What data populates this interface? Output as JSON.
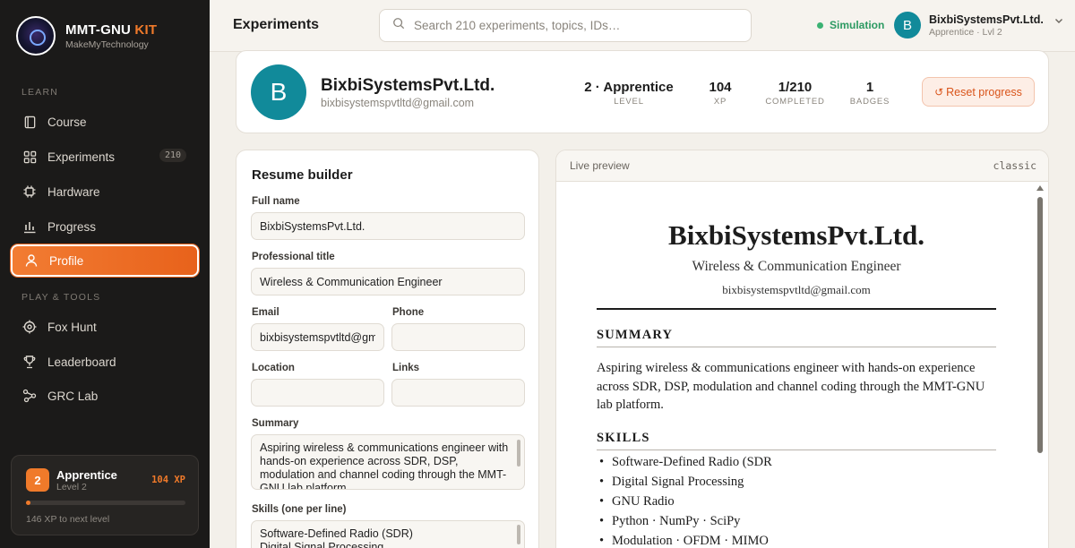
{
  "brand": {
    "title_main": "MMT-GNU ",
    "title_accent": "KIT",
    "subtitle": "MakeMyTechnology"
  },
  "sidebar": {
    "learn_label": "LEARN",
    "tools_label": "PLAY & TOOLS",
    "items": [
      {
        "label": "Course",
        "icon": "book-icon"
      },
      {
        "label": "Experiments",
        "icon": "grid-icon",
        "badge": "210"
      },
      {
        "label": "Hardware",
        "icon": "chip-icon"
      },
      {
        "label": "Progress",
        "icon": "bar-chart-icon"
      },
      {
        "label": "Profile",
        "icon": "user-icon",
        "active": true
      },
      {
        "label": "Fox Hunt",
        "icon": "target-icon"
      },
      {
        "label": "Leaderboard",
        "icon": "trophy-icon"
      },
      {
        "label": "GRC Lab",
        "icon": "graph-icon"
      }
    ],
    "level_card": {
      "level": "2",
      "title": "Apprentice",
      "sub": "Level 2",
      "xp": "104 XP",
      "progress": 0.03,
      "next": "146 XP to next level"
    }
  },
  "topbar": {
    "title": "Experiments",
    "search_placeholder": "Search 210 experiments, topics, IDs…",
    "mode": "Simulation",
    "user": {
      "initial": "B",
      "name": "BixbiSystemsPvt.Ltd.",
      "sub": "Apprentice · Lvl 2"
    }
  },
  "profile": {
    "initial": "B",
    "name": "BixbiSystemsPvt.Ltd.",
    "email": "bixbisystemspvtltd@gmail.com",
    "stats": [
      {
        "value": "2 · Apprentice",
        "label": "LEVEL"
      },
      {
        "value": "104",
        "label": "XP"
      },
      {
        "value": "1/210",
        "label": "COMPLETED"
      },
      {
        "value": "1",
        "label": "BADGES"
      }
    ],
    "reset_label": "Reset progress"
  },
  "builder": {
    "title": "Resume builder",
    "full_name_label": "Full name",
    "full_name": "BixbiSystemsPvt.Ltd.",
    "prof_title_label": "Professional title",
    "prof_title": "Wireless & Communication Engineer",
    "email_label": "Email",
    "email": "bixbisystemspvtltd@gmail.com",
    "phone_label": "Phone",
    "phone": "",
    "location_label": "Location",
    "location": "",
    "links_label": "Links",
    "links": "",
    "summary_label": "Summary",
    "summary": "Aspiring wireless & communications engineer with hands-on experience across SDR, DSP, modulation and channel coding through the MMT-GNU lab platform.",
    "skills_label": "Skills (one per line)",
    "skills": "Software-Defined Radio (SDR)\nDigital Signal Processing"
  },
  "preview": {
    "label": "Live preview",
    "template": "classic",
    "name": "BixbiSystemsPvt.Ltd.",
    "title": "Wireless & Communication Engineer",
    "email": "bixbisystemspvtltd@gmail.com",
    "summary_heading": "SUMMARY",
    "summary": "Aspiring wireless & communications engineer with hands-on experience across SDR, DSP, modulation and channel coding through the MMT-GNU lab platform.",
    "skills_heading": "SKILLS",
    "skills": [
      "Software-Defined Radio (SDR",
      "Digital Signal Processing",
      "GNU Radio",
      "Python · NumPy · SciPy",
      "Modulation · OFDM · MIMO"
    ]
  },
  "colors": {
    "accent": "#f07a2a",
    "sidebar_bg": "#1b1a19",
    "avatar": "#118a9a",
    "status_green": "#3bb273"
  }
}
